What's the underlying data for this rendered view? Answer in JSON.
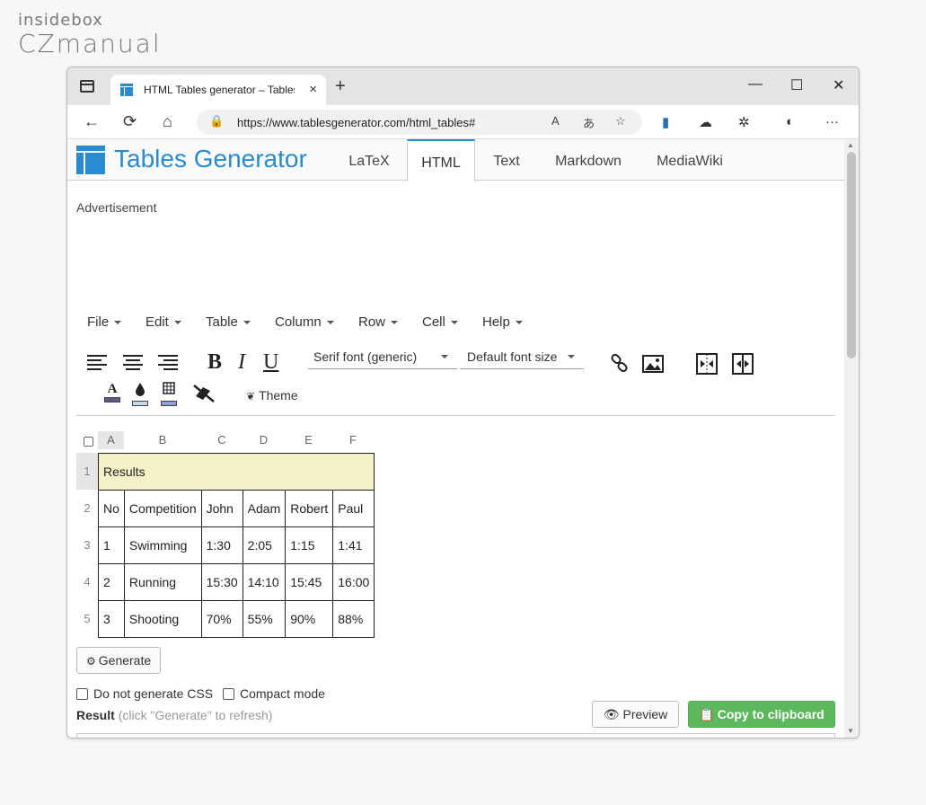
{
  "watermark": {
    "line1": "insidebox",
    "line2": "CZmanual"
  },
  "browser": {
    "tab_title": "HTML Tables generator – TablesGenerator.com",
    "tab_close": "×",
    "new_tab": "+",
    "window_controls": {
      "minimize": "—",
      "maximize": "☐",
      "close": "✕"
    },
    "url": "https://www.tablesgenerator.com/html_tables#",
    "url_icons": {
      "read_aloud": "A",
      "translate": "あ",
      "favorite": "☆"
    },
    "toolbar_icons": {
      "collections": "▮",
      "cloud": "☁",
      "extensions": "✲",
      "profile": "◐",
      "more": "···"
    },
    "nav": {
      "back": "←",
      "refresh": "⟳",
      "home": "⌂",
      "lock": "🔒"
    }
  },
  "site": {
    "logo_text": "Tables Generator",
    "tabs": [
      "LaTeX",
      "HTML",
      "Text",
      "Markdown",
      "MediaWiki"
    ],
    "active_tab": "HTML",
    "advertisement": "Advertisement"
  },
  "menu": [
    "File",
    "Edit",
    "Table",
    "Column",
    "Row",
    "Cell",
    "Help"
  ],
  "toolbar": {
    "bold": "B",
    "italic": "I",
    "underline": "U",
    "font_family": "Serif font (generic)",
    "font_size": "Default font size",
    "theme": "Theme",
    "text_color_glyph": "A",
    "text_color": "#5a5a8c",
    "fill_color": "#c8d8f0",
    "border_color": "#8fa0d8"
  },
  "sheet": {
    "columns": [
      "A",
      "B",
      "C",
      "D",
      "E",
      "F"
    ],
    "row_numbers": [
      "1",
      "2",
      "3",
      "4",
      "5"
    ],
    "title_cell": "Results",
    "header": [
      "No",
      "Competition",
      "John",
      "Adam",
      "Robert",
      "Paul"
    ],
    "rows": [
      [
        "1",
        "Swimming",
        "1:30",
        "2:05",
        "1:15",
        "1:41"
      ],
      [
        "2",
        "Running",
        "15:30",
        "14:10",
        "15:45",
        "16:00"
      ],
      [
        "3",
        "Shooting",
        "70%",
        "55%",
        "90%",
        "88%"
      ]
    ]
  },
  "actions": {
    "generate": "Generate",
    "no_css": "Do not generate CSS",
    "compact": "Compact mode",
    "result_label": "Result",
    "result_hint": "(click \"Generate\" to refresh)",
    "preview": "Preview",
    "copy": "Copy to clipboard"
  },
  "colors": {
    "accent": "#2a8bd0",
    "title_cell": "#f4f0c8",
    "copy_button": "#5cb85c"
  }
}
